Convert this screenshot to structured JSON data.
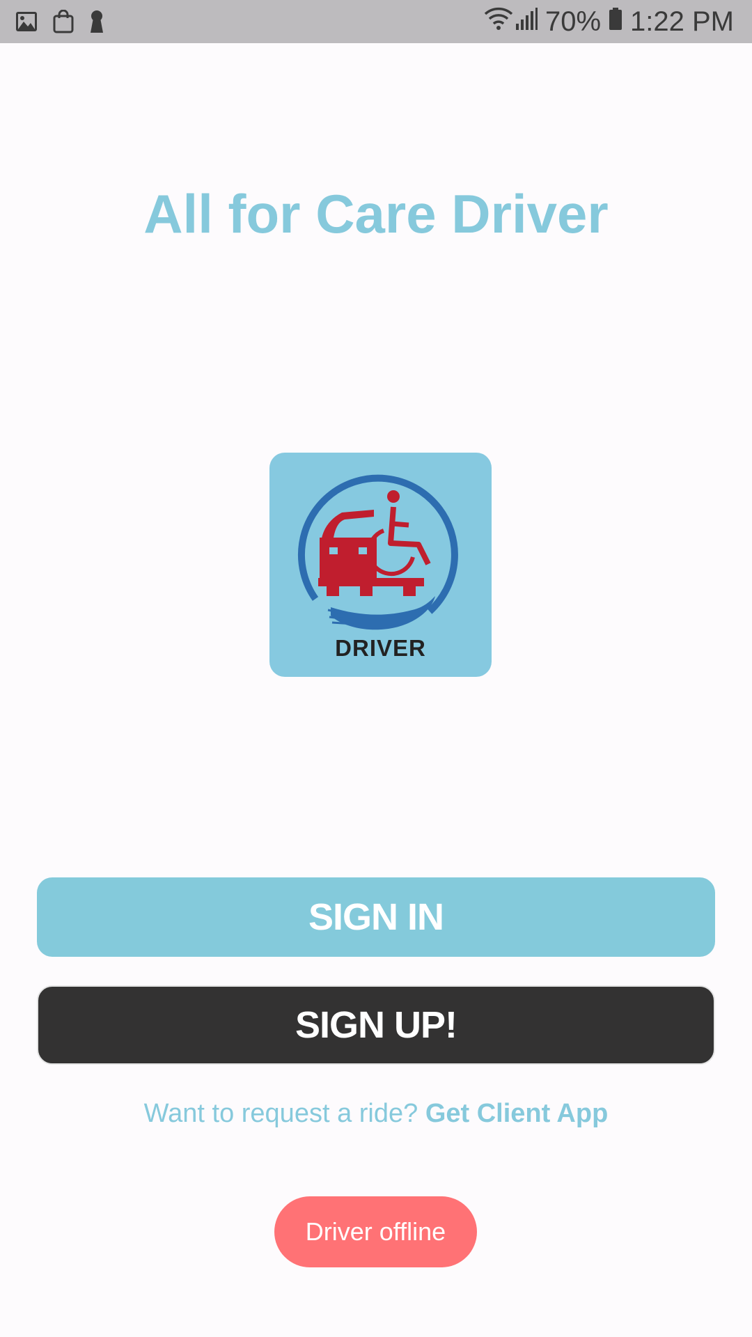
{
  "status_bar": {
    "battery_percent": "70%",
    "time": "1:22 PM",
    "icons": [
      "image-icon",
      "shopping-bag-icon",
      "keyhole-icon",
      "wifi-icon",
      "signal-icon",
      "battery-icon"
    ]
  },
  "app": {
    "title": "All for Care Driver",
    "logo_caption": "DRIVER"
  },
  "buttons": {
    "sign_in": "SIGN IN",
    "sign_up": "SIGN UP!"
  },
  "footer": {
    "prompt": "Want to request a ride?",
    "link": "Get Client App"
  },
  "status_badge": "Driver offline",
  "colors": {
    "accent": "#86c9dc",
    "dark_button": "#333232",
    "offline_badge": "#ff7275",
    "logo_red": "#c01e2e",
    "logo_blue": "#2d6db0"
  }
}
